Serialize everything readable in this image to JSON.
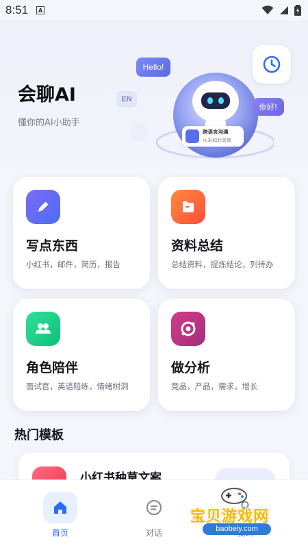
{
  "status_bar": {
    "time": "8:51",
    "notification": "A"
  },
  "hero": {
    "title": "会聊AI",
    "subtitle": "懂你的AI小助手",
    "illustration": {
      "bubble_hello": "Hello!",
      "bubble_nihao": "你好!",
      "bubble_en": "EN",
      "badge_title": "跨语言沟通",
      "badge_sub": "从未如此简单"
    }
  },
  "features": [
    {
      "title": "写点东西",
      "desc": "小红书，邮件，简历，报告",
      "icon": "pencil-icon",
      "color_from": "#7b6cf6",
      "color_to": "#4d6df2"
    },
    {
      "title": "资料总结",
      "desc": "总结资料，提炼结论，列待办",
      "icon": "folder-icon",
      "color_from": "#ff8a3d",
      "color_to": "#ff4e3a"
    },
    {
      "title": "角色陪伴",
      "desc": "面试官，英语陪练，情绪树洞",
      "icon": "people-icon",
      "color_from": "#2fe09a",
      "color_to": "#10c07a"
    },
    {
      "title": "做分析",
      "desc": "竞品，产品，需求，增长",
      "icon": "analysis-icon",
      "color_from": "#d43c8a",
      "color_to": "#a12f7a"
    }
  ],
  "templates": {
    "section_title": "热门模板",
    "items": [
      {
        "title": "小红书种草文案"
      }
    ]
  },
  "nav": {
    "items": [
      {
        "label": "首页",
        "icon": "home-icon",
        "active": true
      },
      {
        "label": "对话",
        "icon": "chat-icon",
        "active": false
      },
      {
        "label": "我的",
        "icon": "user-icon",
        "active": false
      }
    ]
  },
  "watermark": {
    "text": "宝贝游戏网",
    "url": "baobeiy.com"
  },
  "colors": {
    "accent": "#2d6cf6",
    "background": "#f5f6fb"
  }
}
